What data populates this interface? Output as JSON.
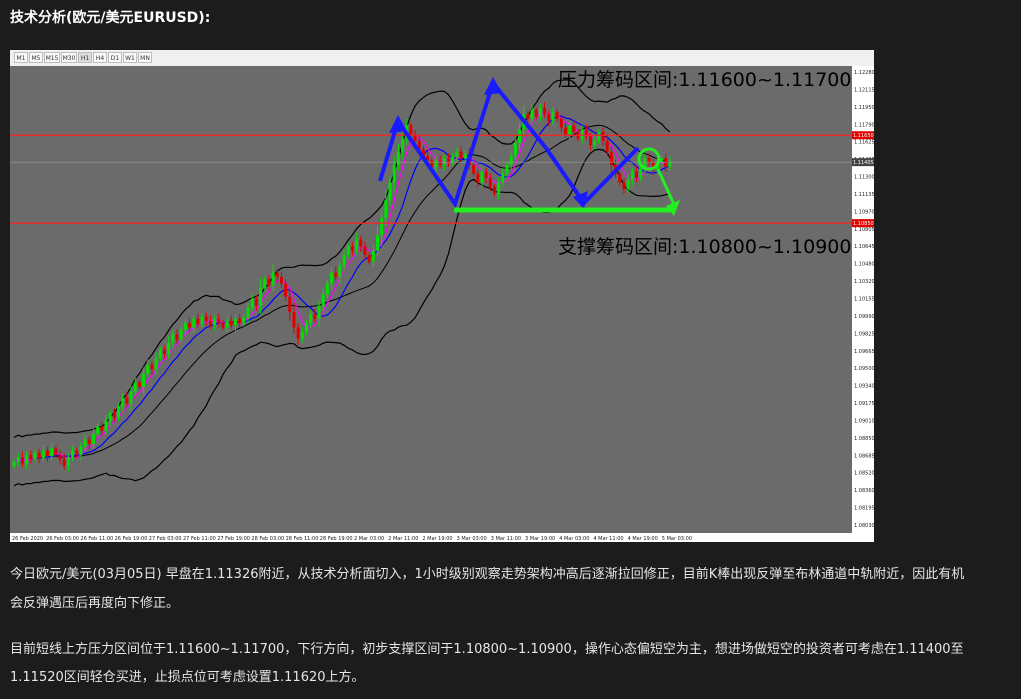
{
  "article": {
    "title": "技术分析(欧元/美元EURUSD):",
    "para1_line1": "今日欧元/美元(03月05日) 早盘在1.11326附近，从技术分析面切入，1小时级别观察走势架构冲高后逐渐拉回修正，目前K棒出现反弹至布林通道中轨附近，因此有机",
    "para1_line2": "会反弹遇压后再度向下修正。",
    "para2_line1": "目前短线上方压力区间位于1.11600~1.11700，下行方向，初步支撑区间于1.10800~1.10900，操作心态偏短空为主，想进场做短空的投资者可考虑在1.11400至",
    "para2_line2": "1.11520区间轻仓买进，止损点位可考虑设置1.11620上方。"
  },
  "toolbar": {
    "timeframes": [
      "M1",
      "M5",
      "M15",
      "M30",
      "H1",
      "H4",
      "D1",
      "W1",
      "MN"
    ],
    "active": "H1"
  },
  "chart_data": {
    "type": "candlestick",
    "symbol": "EURUSD",
    "timeframe": "H1",
    "ylim": [
      1.0803,
      1.1228
    ],
    "y_ticks": [
      "1.12280",
      "1.12115",
      "1.11950",
      "1.11790",
      "1.11625",
      "1.11465",
      "1.11300",
      "1.11135",
      "1.10970",
      "1.10805",
      "1.10645",
      "1.10480",
      "1.10320",
      "1.10155",
      "1.09990",
      "1.09825",
      "1.09665",
      "1.09500",
      "1.09340",
      "1.09175",
      "1.09010",
      "1.08850",
      "1.08685",
      "1.08520",
      "1.08360",
      "1.08195",
      "1.08030"
    ],
    "x_ticks": [
      "26 Feb 2020",
      "26 Feb 03:00",
      "26 Feb 11:00",
      "26 Feb 19:00",
      "27 Feb 03:00",
      "27 Feb 11:00",
      "27 Feb 19:00",
      "28 Feb 03:00",
      "28 Feb 11:00",
      "28 Feb 19:00",
      "2 Mar 03:00",
      "2 Mar 11:00",
      "2 Mar 19:00",
      "3 Mar 03:00",
      "3 Mar 11:00",
      "3 Mar 19:00",
      "4 Mar 03:00",
      "4 Mar 11:00",
      "4 Mar 19:00",
      "5 Mar 03:00"
    ],
    "resistance_label": "压力筹码区间:1.11600~1.11700",
    "support_label": "支撑筹码区间:1.10800~1.10900",
    "resistance_level": 1.1165,
    "support_level": 1.1085,
    "current_price_label": "1.11405",
    "resistance_tag": "1.11650",
    "support_tag": "1.10850",
    "colors": {
      "bull": "#00e000",
      "bear": "#e00000",
      "bands": "#000000",
      "ma_fast": "#ff00ff",
      "ma_mid": "#0000ff",
      "levels": "#ff2020",
      "arrows": "#1a1aff",
      "support_arrow": "#22ee22"
    },
    "close": [
      1.0868,
      1.0872,
      1.0866,
      1.0874,
      1.087,
      1.0876,
      1.0871,
      1.0878,
      1.0873,
      1.088,
      1.0874,
      1.087,
      1.0864,
      1.0872,
      1.0878,
      1.0874,
      1.0882,
      1.0888,
      1.0884,
      1.0893,
      1.09,
      1.0896,
      1.0905,
      1.0912,
      1.0908,
      1.0918,
      1.0926,
      1.0921,
      1.0932,
      1.094,
      1.0936,
      1.0948,
      1.0956,
      1.0952,
      1.0962,
      1.097,
      1.0966,
      1.0976,
      1.0984,
      1.0979,
      1.0988,
      1.0994,
      1.099,
      1.0998,
      1.0993,
      1.1,
      1.0996,
      1.0992,
      1.0998,
      1.0994,
      1.099,
      1.0996,
      1.0992,
      1.0998,
      1.0994,
      1.0999,
      1.1008,
      1.1016,
      1.101,
      1.1026,
      1.1034,
      1.1028,
      1.104,
      1.1036,
      1.103,
      1.1018,
      1.1004,
      1.099,
      1.098,
      1.0986,
      1.0994,
      1.1002,
      1.0998,
      1.101,
      1.102,
      1.103,
      1.104,
      1.1036,
      1.1046,
      1.1056,
      1.1064,
      1.106,
      1.107,
      1.1064,
      1.1056,
      1.105,
      1.106,
      1.1074,
      1.109,
      1.1106,
      1.1122,
      1.1138,
      1.115,
      1.1162,
      1.1174,
      1.1166,
      1.116,
      1.1152,
      1.1146,
      1.1142,
      1.1136,
      1.1142,
      1.1138,
      1.1144,
      1.114,
      1.1146,
      1.115,
      1.1144,
      1.1148,
      1.1138,
      1.113,
      1.1122,
      1.1132,
      1.1126,
      1.1118,
      1.1112,
      1.1122,
      1.113,
      1.1138,
      1.1146,
      1.1158,
      1.117,
      1.1184,
      1.118,
      1.1188,
      1.1182,
      1.119,
      1.1184,
      1.1178,
      1.1186,
      1.118,
      1.1172,
      1.1166,
      1.1174,
      1.1168,
      1.1162,
      1.117,
      1.1164,
      1.1156,
      1.116,
      1.1168,
      1.116,
      1.115,
      1.1138,
      1.113,
      1.1122,
      1.1116,
      1.1124,
      1.1132,
      1.1126,
      1.1136,
      1.1144,
      1.114,
      1.1134,
      1.114,
      1.1144,
      1.1136,
      1.1141
    ]
  }
}
